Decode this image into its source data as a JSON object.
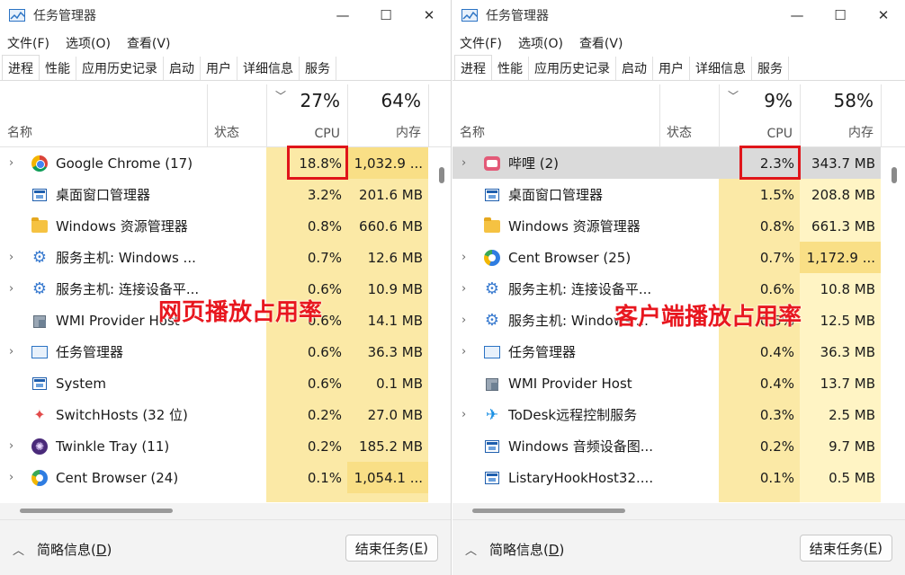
{
  "colors": {
    "heat_light": "#fff4c4",
    "heat_mid": "#fbe9a6",
    "heat_strong": "#f9df86",
    "annotation": "#e8171f"
  },
  "left": {
    "title": "任务管理器",
    "window_buttons": {
      "minimize": "—",
      "maximize": "☐",
      "close": "✕"
    },
    "menu": [
      "文件(F)",
      "选项(O)",
      "查看(V)"
    ],
    "tabs": [
      "进程",
      "性能",
      "应用历史记录",
      "启动",
      "用户",
      "详细信息",
      "服务"
    ],
    "header": {
      "name": "名称",
      "status": "状态",
      "cpu_pct": "27%",
      "cpu": "CPU",
      "mem_pct": "64%",
      "mem": "内存"
    },
    "rows": [
      {
        "name": "Google Chrome (17)",
        "cpu": "18.8%",
        "mem": "1,032.9 ...",
        "icon": "chrome-icon",
        "expand": true
      },
      {
        "name": "桌面窗口管理器",
        "cpu": "3.2%",
        "mem": "201.6 MB",
        "icon": "window-icon",
        "expand": false
      },
      {
        "name": "Windows 资源管理器",
        "cpu": "0.8%",
        "mem": "660.6 MB",
        "icon": "folder-icon",
        "expand": false
      },
      {
        "name": "服务主机: Windows ...",
        "cpu": "0.7%",
        "mem": "12.6 MB",
        "icon": "gear-icon",
        "expand": true
      },
      {
        "name": "服务主机: 连接设备平...",
        "cpu": "0.6%",
        "mem": "10.9 MB",
        "icon": "gear-icon",
        "expand": true
      },
      {
        "name": "WMI Provider Host",
        "cpu": "0.6%",
        "mem": "14.1 MB",
        "icon": "wmi-icon",
        "expand": false
      },
      {
        "name": "任务管理器",
        "cpu": "0.6%",
        "mem": "36.3 MB",
        "icon": "task-manager-icon",
        "expand": true
      },
      {
        "name": "System",
        "cpu": "0.6%",
        "mem": "0.1 MB",
        "icon": "window-icon",
        "expand": false
      },
      {
        "name": "SwitchHosts (32 位)",
        "cpu": "0.2%",
        "mem": "27.0 MB",
        "icon": "switchhosts-icon",
        "expand": false
      },
      {
        "name": "Twinkle Tray (11)",
        "cpu": "0.2%",
        "mem": "185.2 MB",
        "icon": "twinkle-icon",
        "expand": true
      },
      {
        "name": "Cent Browser (24)",
        "cpu": "0.1%",
        "mem": "1,054.1 ...",
        "icon": "cent-browser-icon",
        "expand": true
      }
    ],
    "annotation": "网页播放占用率",
    "footer": {
      "fewer": "简略信息(",
      "fewer_key": "D",
      "fewer_end": ")",
      "end_task": "结束任务(",
      "end_key": "E",
      "end_end": ")"
    }
  },
  "right": {
    "title": "任务管理器",
    "window_buttons": {
      "minimize": "—",
      "maximize": "☐",
      "close": "✕"
    },
    "menu": [
      "文件(F)",
      "选项(O)",
      "查看(V)"
    ],
    "tabs": [
      "进程",
      "性能",
      "应用历史记录",
      "启动",
      "用户",
      "详细信息",
      "服务"
    ],
    "header": {
      "name": "名称",
      "status": "状态",
      "cpu_pct": "9%",
      "cpu": "CPU",
      "mem_pct": "58%",
      "mem": "内存"
    },
    "rows": [
      {
        "name": "哔哩 (2)",
        "cpu": "2.3%",
        "mem": "343.7 MB",
        "icon": "bilibili-icon",
        "expand": true
      },
      {
        "name": "桌面窗口管理器",
        "cpu": "1.5%",
        "mem": "208.8 MB",
        "icon": "window-icon",
        "expand": false
      },
      {
        "name": "Windows 资源管理器",
        "cpu": "0.8%",
        "mem": "661.3 MB",
        "icon": "folder-icon",
        "expand": false
      },
      {
        "name": "Cent Browser (25)",
        "cpu": "0.7%",
        "mem": "1,172.9 ...",
        "icon": "cent-browser-icon",
        "expand": true
      },
      {
        "name": "服务主机: 连接设备平...",
        "cpu": "0.6%",
        "mem": "10.8 MB",
        "icon": "gear-icon",
        "expand": true
      },
      {
        "name": "服务主机: Windows ...",
        "cpu": "0.5%",
        "mem": "12.5 MB",
        "icon": "gear-icon",
        "expand": true
      },
      {
        "name": "任务管理器",
        "cpu": "0.4%",
        "mem": "36.3 MB",
        "icon": "task-manager-icon",
        "expand": true
      },
      {
        "name": "WMI Provider Host",
        "cpu": "0.4%",
        "mem": "13.7 MB",
        "icon": "wmi-icon",
        "expand": false
      },
      {
        "name": "ToDesk远程控制服务",
        "cpu": "0.3%",
        "mem": "2.5 MB",
        "icon": "todesk-icon",
        "expand": true
      },
      {
        "name": "Windows 音频设备图...",
        "cpu": "0.2%",
        "mem": "9.7 MB",
        "icon": "window-icon",
        "expand": false
      },
      {
        "name": "ListaryHookHost32....",
        "cpu": "0.1%",
        "mem": "0.5 MB",
        "icon": "window-icon",
        "expand": false
      }
    ],
    "annotation": "客户端播放占用率",
    "footer": {
      "fewer": "简略信息(",
      "fewer_key": "D",
      "fewer_end": ")",
      "end_task": "结束任务(",
      "end_key": "E",
      "end_end": ")"
    }
  }
}
